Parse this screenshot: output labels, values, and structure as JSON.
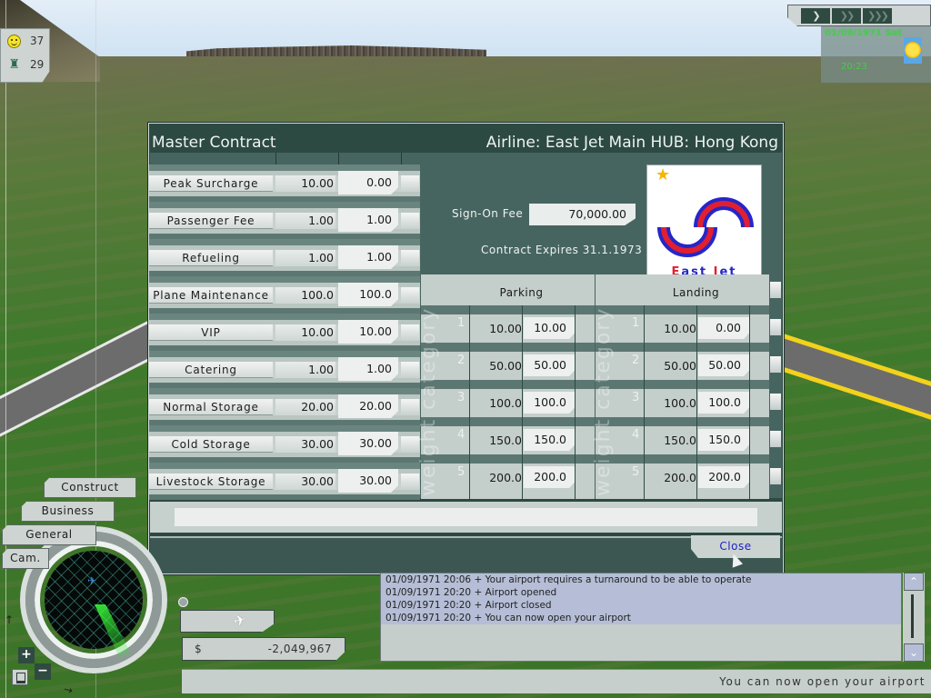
{
  "hud": {
    "stats": [
      {
        "icon": "smiley-icon",
        "value": "37"
      },
      {
        "icon": "control-tower-icon",
        "value": "29"
      }
    ],
    "speed_buttons": [
      {
        "name": "play",
        "glyph": "❯"
      },
      {
        "name": "fast",
        "glyph": "❯❯"
      },
      {
        "name": "fastest",
        "glyph": "❯❯❯"
      }
    ],
    "date": "01/09/1971 Sat",
    "time": "20:23",
    "weather": "sunny"
  },
  "dialog": {
    "title": "Master Contract",
    "airline_header": "Airline: East Jet Main HUB: Hong Kong",
    "fees": [
      {
        "label": "Peak Surcharge",
        "default": "10.00",
        "value": "0.00"
      },
      {
        "label": "Passenger Fee",
        "default": "1.00",
        "value": "1.00"
      },
      {
        "label": "Refueling",
        "default": "1.00",
        "value": "1.00"
      },
      {
        "label": "Plane Maintenance",
        "default": "100.0",
        "value": "100.0"
      },
      {
        "label": "VIP",
        "default": "10.00",
        "value": "10.00"
      },
      {
        "label": "Catering",
        "default": "1.00",
        "value": "1.00"
      },
      {
        "label": "Normal Storage",
        "default": "20.00",
        "value": "20.00"
      },
      {
        "label": "Cold Storage",
        "default": "30.00",
        "value": "30.00"
      },
      {
        "label": "Livestock Storage",
        "default": "30.00",
        "value": "30.00"
      }
    ],
    "sign_on_fee_label": "Sign-On Fee",
    "sign_on_fee_value": "70,000.00",
    "contract_expires": "Contract Expires 31.1.1973",
    "logo": {
      "name_first": "E",
      "name_rest": "ast ",
      "name_first2": "J",
      "name_rest2": "et",
      "colors": {
        "red": "#e02030",
        "blue": "#2626c8"
      }
    },
    "weight_category_label": "weight category",
    "parking": {
      "header": "Parking",
      "rows": [
        {
          "cat": "1",
          "default": "10.00",
          "value": "10.00"
        },
        {
          "cat": "2",
          "default": "50.00",
          "value": "50.00"
        },
        {
          "cat": "3",
          "default": "100.0",
          "value": "100.0"
        },
        {
          "cat": "4",
          "default": "150.0",
          "value": "150.0"
        },
        {
          "cat": "5",
          "default": "200.0",
          "value": "200.0"
        }
      ]
    },
    "landing": {
      "header": "Landing",
      "rows": [
        {
          "cat": "1",
          "default": "10.00",
          "value": "0.00"
        },
        {
          "cat": "2",
          "default": "50.00",
          "value": "50.00"
        },
        {
          "cat": "3",
          "default": "100.0",
          "value": "100.0"
        },
        {
          "cat": "4",
          "default": "150.0",
          "value": "150.0"
        },
        {
          "cat": "5",
          "default": "200.0",
          "value": "200.0"
        }
      ]
    },
    "message_field": "",
    "close_label": "Close"
  },
  "log": {
    "lines": [
      "01/09/1971 20:06 + Your airport requires a turnaround to be able to operate",
      "01/09/1971 20:20 + Airport opened",
      "01/09/1971 20:20 + Airport closed",
      "01/09/1971 20:20 + You can now open your airport"
    ],
    "scroll_up": "⌃",
    "scroll_down": "⌄"
  },
  "status_bar": "You can now open your airport",
  "nav": {
    "tabs": [
      "Construct",
      "Business",
      "General",
      "Cam."
    ],
    "zoom_in": "+",
    "zoom_out": "−"
  },
  "finance": {
    "currency": "$",
    "balance": "-2,049,967"
  }
}
